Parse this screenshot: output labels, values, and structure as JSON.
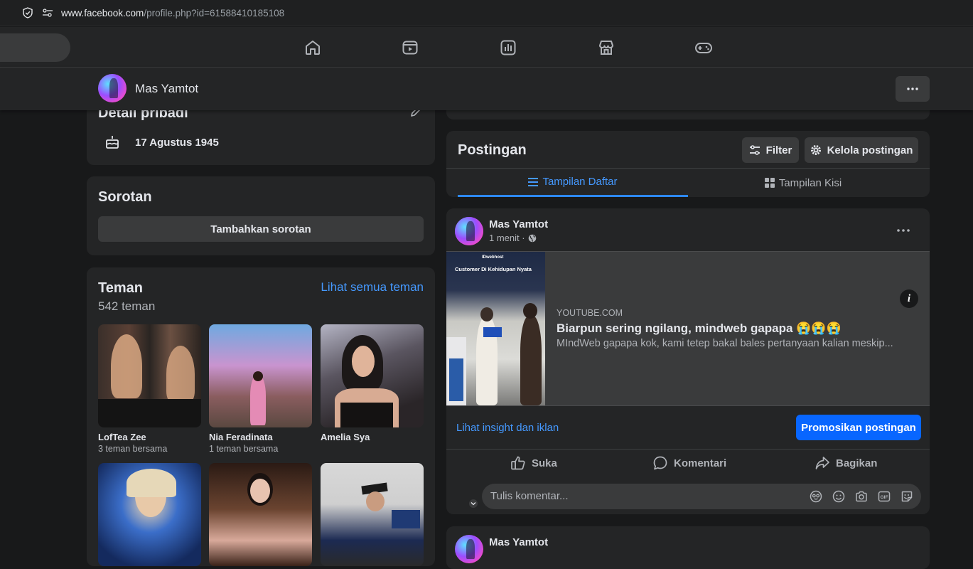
{
  "browser": {
    "url_host": "www.facebook.com",
    "url_path": "/profile.php?id=61588410185108"
  },
  "nav_icons": [
    "home-icon",
    "video-icon",
    "dashboard-icon",
    "marketplace-icon",
    "gaming-icon"
  ],
  "profile_header": {
    "name": "Mas Yamtot"
  },
  "detail": {
    "title": "Detail pribadi",
    "birthday": "17 Agustus 1945"
  },
  "sorotan": {
    "title": "Sorotan",
    "add_label": "Tambahkan sorotan"
  },
  "teman": {
    "title": "Teman",
    "see_all": "Lihat semua teman",
    "count": "542 teman",
    "friends": [
      {
        "name": "LofTea Zee",
        "mutual": "3 teman bersama"
      },
      {
        "name": "Nia Feradinata",
        "mutual": "1 teman bersama"
      },
      {
        "name": "Amelia Sya",
        "mutual": ""
      },
      {
        "name": "",
        "mutual": ""
      },
      {
        "name": "",
        "mutual": ""
      },
      {
        "name": "",
        "mutual": ""
      }
    ]
  },
  "postingan": {
    "title": "Postingan",
    "filter_label": "Filter",
    "manage_label": "Kelola postingan",
    "tab_list": "Tampilan Daftar",
    "tab_grid": "Tampilan Kisi"
  },
  "post": {
    "author": "Mas Yamtot",
    "time": "1 menit ·",
    "thumb_brand": "IDwebhost",
    "thumb_caption": "Customer Di Kehidupan Nyata",
    "link_domain": "YOUTUBE.COM",
    "link_title": "Biarpun sering ngilang, mindweb gapapa 😭😭😭",
    "link_desc": "MIndWeb gapapa kok, kami tetep bakal bales pertanyaan kalian meskip...",
    "insight_label": "Lihat insight dan iklan",
    "promote_label": "Promosikan postingan",
    "like_label": "Suka",
    "comment_label": "Komentari",
    "share_label": "Bagikan",
    "comment_placeholder": "Tulis komentar..."
  },
  "post2": {
    "author": "Mas Yamtot"
  }
}
